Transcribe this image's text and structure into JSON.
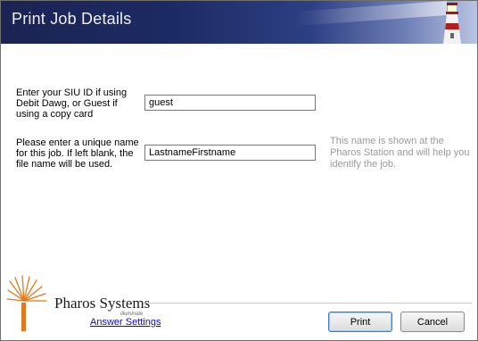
{
  "window": {
    "title": "Print Job Details"
  },
  "form": {
    "id_label": "Enter your SIU ID if using Debit Dawg, or Guest if using a copy card",
    "id_value": "guest",
    "name_label": "Please enter a unique name for this job. If left blank, the file name will be used.",
    "name_value": "LastnameFirstname",
    "name_hint": "This name is shown at the Pharos Station and will help you identify the job."
  },
  "footer": {
    "brand": "Pharos Systems",
    "brand_sub": "illuminate",
    "answer_settings": "Answer Settings",
    "print_label": "Print",
    "cancel_label": "Cancel"
  },
  "colors": {
    "banner_dark": "#1b2352",
    "banner_light": "#b9c4e2",
    "link": "#0a0ad0",
    "hint": "#9a9a9a",
    "logo_orange": "#e07a1f"
  }
}
